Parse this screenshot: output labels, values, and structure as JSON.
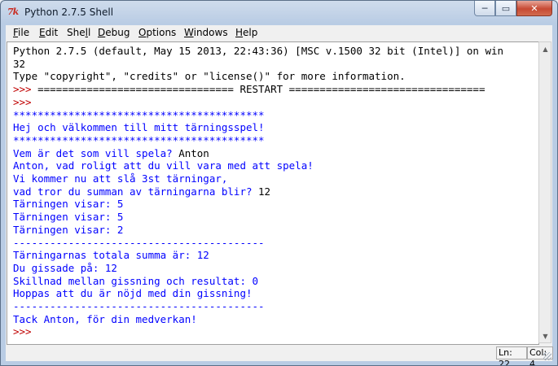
{
  "window": {
    "title": "Python 2.7.5 Shell",
    "icon_glyph": "7k",
    "buttons": {
      "minimize": "─",
      "maximize": "▭",
      "close": "✕"
    }
  },
  "menubar": [
    {
      "pre": "",
      "u": "F",
      "post": "ile"
    },
    {
      "pre": "",
      "u": "E",
      "post": "dit"
    },
    {
      "pre": "She",
      "u": "l",
      "post": "l"
    },
    {
      "pre": "",
      "u": "D",
      "post": "ebug"
    },
    {
      "pre": "",
      "u": "O",
      "post": "ptions"
    },
    {
      "pre": "",
      "u": "W",
      "post": "indows"
    },
    {
      "pre": "",
      "u": "H",
      "post": "elp"
    }
  ],
  "shell": {
    "lines": [
      {
        "segs": [
          {
            "t": "Python 2.7.5 (default, May 15 2013, 22:43:36) [MSC v.1500 32 bit (Intel)] on win",
            "c": "black"
          }
        ]
      },
      {
        "segs": [
          {
            "t": "32",
            "c": "black"
          }
        ]
      },
      {
        "segs": [
          {
            "t": "Type \"copyright\", \"credits\" or \"license()\" for more information.",
            "c": "black"
          }
        ]
      },
      {
        "segs": [
          {
            "t": ">>> ",
            "c": "red"
          },
          {
            "t": "================================ RESTART ================================",
            "c": "black"
          }
        ]
      },
      {
        "segs": [
          {
            "t": ">>> ",
            "c": "red"
          }
        ]
      },
      {
        "segs": [
          {
            "t": "*****************************************",
            "c": "blue"
          }
        ]
      },
      {
        "segs": [
          {
            "t": "Hej och välkommen till mitt tärningsspel!",
            "c": "blue"
          }
        ]
      },
      {
        "segs": [
          {
            "t": "*****************************************",
            "c": "blue"
          }
        ]
      },
      {
        "segs": [
          {
            "t": "Vem är det som vill spela? ",
            "c": "blue"
          },
          {
            "t": "Anton",
            "c": "black"
          }
        ]
      },
      {
        "segs": [
          {
            "t": "Anton, vad roligt att du vill vara med att spela!",
            "c": "blue"
          }
        ]
      },
      {
        "segs": [
          {
            "t": "Vi kommer nu att slå 3st tärningar,",
            "c": "blue"
          }
        ]
      },
      {
        "segs": [
          {
            "t": "vad tror du summan av tärningarna blir? ",
            "c": "blue"
          },
          {
            "t": "12",
            "c": "black"
          }
        ]
      },
      {
        "segs": [
          {
            "t": "Tärningen visar: 5",
            "c": "blue"
          }
        ]
      },
      {
        "segs": [
          {
            "t": "Tärningen visar: 5",
            "c": "blue"
          }
        ]
      },
      {
        "segs": [
          {
            "t": "Tärningen visar: 2",
            "c": "blue"
          }
        ]
      },
      {
        "segs": [
          {
            "t": "-----------------------------------------",
            "c": "blue"
          }
        ]
      },
      {
        "segs": [
          {
            "t": "Tärningarnas totala summa är: 12",
            "c": "blue"
          }
        ]
      },
      {
        "segs": [
          {
            "t": "Du gissade på: 12",
            "c": "blue"
          }
        ]
      },
      {
        "segs": [
          {
            "t": "Skillnad mellan gissning och resultat: 0",
            "c": "blue"
          }
        ]
      },
      {
        "segs": [
          {
            "t": "Hoppas att du är nöjd med din gissning!",
            "c": "blue"
          }
        ]
      },
      {
        "segs": [
          {
            "t": "-----------------------------------------",
            "c": "blue"
          }
        ]
      },
      {
        "segs": [
          {
            "t": "Tack Anton, för din medverkan!",
            "c": "blue"
          }
        ]
      },
      {
        "segs": [
          {
            "t": ">>> ",
            "c": "red"
          }
        ]
      }
    ]
  },
  "scrollbar": {
    "up": "▲",
    "down": "▼"
  },
  "status": {
    "line": "Ln: 22",
    "col": "Col: 4"
  },
  "colors": {
    "prompt": "#c00000",
    "output": "#0000ff",
    "input": "#000000"
  }
}
